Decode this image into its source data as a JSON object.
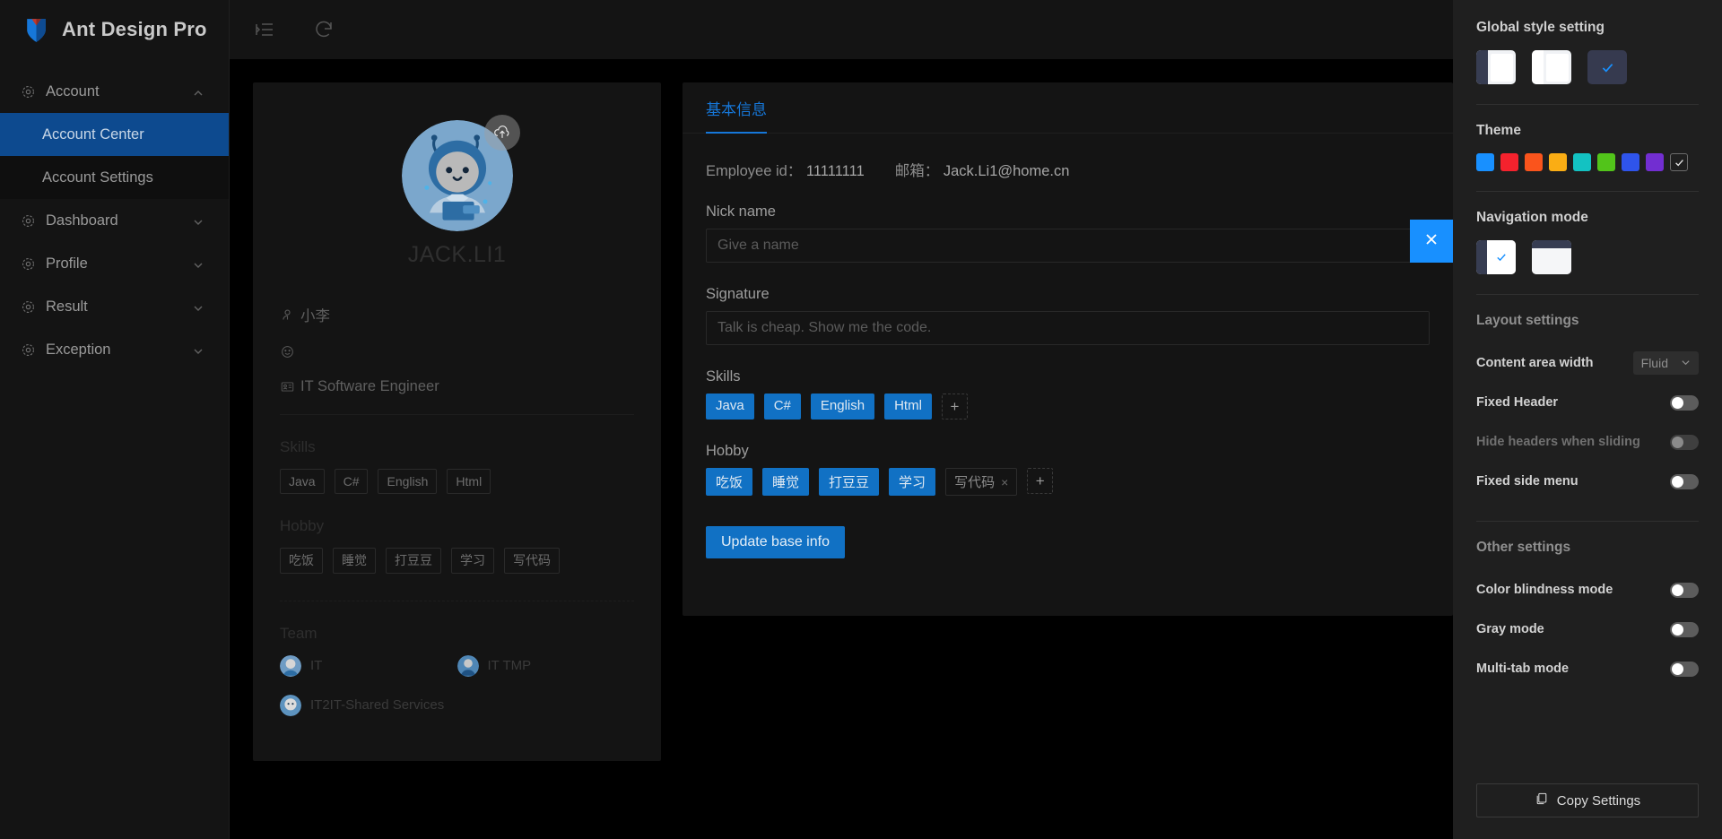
{
  "brand": {
    "title": "Ant Design Pro",
    "logo_icon": "shield-logo-icon"
  },
  "sidebar": {
    "items": [
      {
        "label": "Account",
        "icon": "account-icon",
        "arrow": "chevron-up-icon",
        "expanded": true,
        "children": [
          {
            "label": "Account Center",
            "active": true
          },
          {
            "label": "Account Settings",
            "active": false
          }
        ]
      },
      {
        "label": "Dashboard",
        "icon": "dashboard-icon",
        "arrow": "chevron-down-icon",
        "expanded": false,
        "children": []
      },
      {
        "label": "Profile",
        "icon": "profile-icon",
        "arrow": "chevron-down-icon",
        "expanded": false,
        "children": []
      },
      {
        "label": "Result",
        "icon": "result-icon",
        "arrow": "chevron-down-icon",
        "expanded": false,
        "children": []
      },
      {
        "label": "Exception",
        "icon": "exception-icon",
        "arrow": "chevron-down-icon",
        "expanded": false,
        "children": []
      }
    ]
  },
  "topbar": {
    "collapse_icon": "menu-fold-icon",
    "refresh_icon": "refresh-icon"
  },
  "profile": {
    "avatar_icon": "user-avatar-illustration",
    "upload_icon": "cloud-upload-icon",
    "display_name": "JACK.LI1",
    "rows": [
      {
        "icon": "user-icon",
        "text": "小李"
      },
      {
        "icon": "smile-icon",
        "text": ""
      },
      {
        "icon": "id-card-icon",
        "text": "IT Software Engineer"
      }
    ],
    "skills_title": "Skills",
    "skills": [
      "Java",
      "C#",
      "English",
      "Html"
    ],
    "hobby_title": "Hobby",
    "hobby": [
      "吃饭",
      "睡觉",
      "打豆豆",
      "学习",
      "写代码"
    ],
    "team_title": "Team",
    "teams": [
      "IT",
      "IT TMP",
      "IT2IT-Shared Services"
    ]
  },
  "form": {
    "tabs": [
      {
        "label": "基本信息",
        "active": true
      }
    ],
    "employee_id_label": "Employee id：",
    "employee_id_value": "11111111",
    "email_label": "邮箱：",
    "email_value": "Jack.Li1@home.cn",
    "nickname_label": "Nick name",
    "nickname_value": "",
    "nickname_placeholder": "Give a name",
    "signature_label": "Signature",
    "signature_value": "",
    "signature_placeholder": "Talk is cheap. Show me the code.",
    "skills_label": "Skills",
    "skills": [
      "Java",
      "C#",
      "English",
      "Html"
    ],
    "skills_add": "+",
    "hobby_label": "Hobby",
    "hobby_blue": [
      "吃饭",
      "睡觉",
      "打豆豆",
      "学习"
    ],
    "hobby_editable": {
      "text": "写代码",
      "close_icon": "close-small-icon"
    },
    "hobby_add": "+",
    "submit_label": "Update base info",
    "close_fab_icon": "close-icon"
  },
  "settings": {
    "global_style_title": "Global style setting",
    "style_thumbs": [
      {
        "name": "dark-sidebar",
        "selected": false
      },
      {
        "name": "light",
        "selected": false
      },
      {
        "name": "realdark",
        "selected": true
      }
    ],
    "theme_title": "Theme",
    "theme_colors": [
      "#1890ff",
      "#f5222d",
      "#fa541c",
      "#faad14",
      "#13c2c2",
      "#52c41a",
      "#2f54eb",
      "#722ed1"
    ],
    "theme_selected_index": 8,
    "nav_mode_title": "Navigation mode",
    "nav_modes": [
      {
        "name": "side-menu",
        "selected": true
      },
      {
        "name": "top-menu",
        "selected": false
      }
    ],
    "layout_title": "Layout settings",
    "layout_rows": [
      {
        "label": "Content area width",
        "type": "select",
        "value": "Fluid",
        "dim": false
      },
      {
        "label": "Fixed Header",
        "type": "switch",
        "on": false,
        "dim": false
      },
      {
        "label": "Hide headers when sliding",
        "type": "switch",
        "on": false,
        "dim": true
      },
      {
        "label": "Fixed side menu",
        "type": "switch",
        "on": false,
        "dim": false
      }
    ],
    "other_title": "Other settings",
    "other_rows": [
      {
        "label": "Color blindness mode",
        "type": "switch",
        "on": false,
        "dim": false
      },
      {
        "label": "Gray mode",
        "type": "switch",
        "on": false,
        "dim": false
      },
      {
        "label": "Multi-tab mode",
        "type": "switch",
        "on": false,
        "dim": false
      }
    ],
    "copy_label": "Copy Settings",
    "copy_icon": "copy-icon",
    "chevron_icon": "chevron-down-icon",
    "check_icon": "check-icon"
  }
}
